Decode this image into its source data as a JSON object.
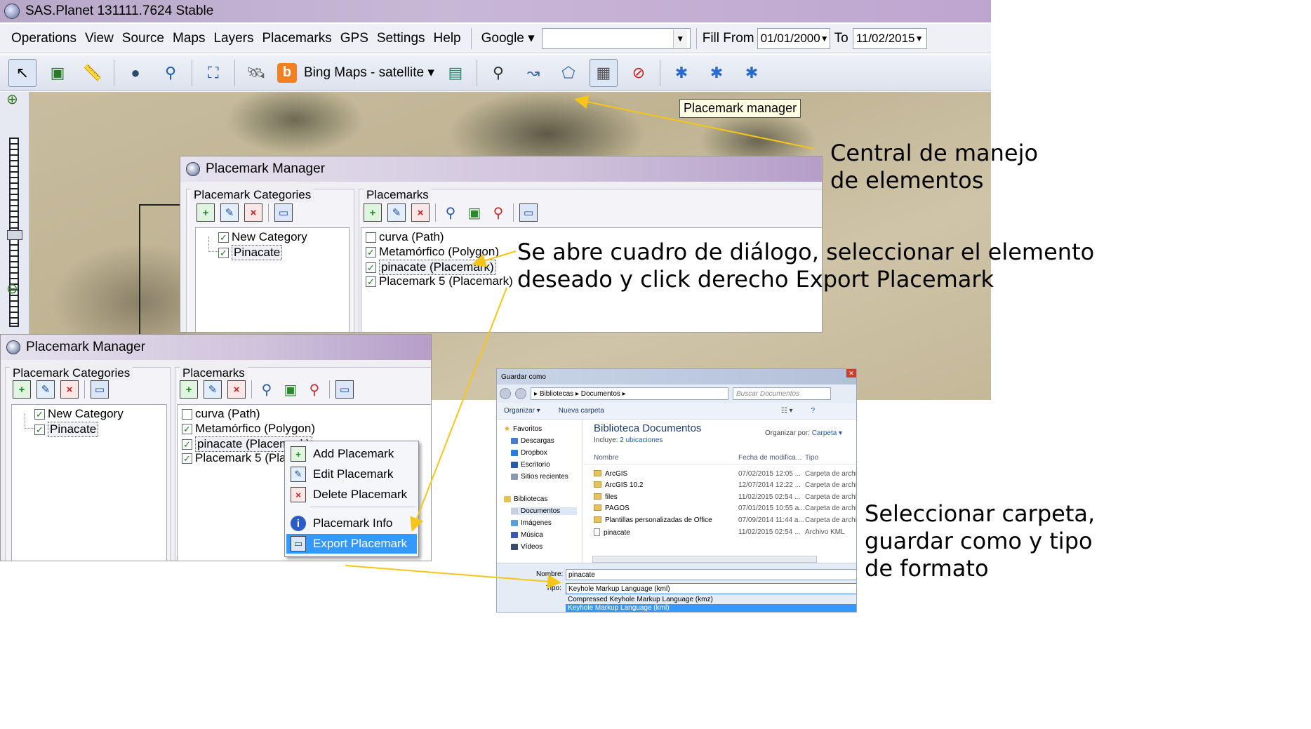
{
  "sas_window": {
    "title": "SAS.Planet 131111.7624 Stable",
    "menu": [
      "Operations",
      "View",
      "Source",
      "Maps",
      "Layers",
      "Placemarks",
      "GPS",
      "Settings",
      "Help"
    ],
    "search_source": "Google",
    "search_value": "",
    "fill_from_label": "Fill From",
    "fill_from_value": "01/01/2000",
    "fill_to_label": "To",
    "fill_to_value": "11/02/2015",
    "map_source_label": "Bing Maps - satellite",
    "zoom_level": "z12",
    "tooltip": "Placemark manager"
  },
  "placemark_manager_back": {
    "title": "Placemark Manager",
    "categories_label": "Placemark Categories",
    "placemarks_label": "Placemarks",
    "categories": [
      {
        "label": "New Category",
        "checked": true
      },
      {
        "label": "Pinacate",
        "checked": true
      }
    ],
    "placemarks": [
      {
        "label": "curva (Path)",
        "checked": false
      },
      {
        "label": "Metamórfico (Polygon)",
        "checked": true
      },
      {
        "label": "pinacate (Placemark)",
        "checked": true
      },
      {
        "label": "Placemark 5 (Placemark)",
        "checked": true
      }
    ]
  },
  "placemark_manager_front": {
    "title": "Placemark Manager",
    "categories_label": "Placemark Categories",
    "placemarks_label": "Placemarks",
    "categories": [
      {
        "label": "New Category",
        "checked": true
      },
      {
        "label": "Pinacate",
        "checked": true
      }
    ],
    "placemarks": [
      {
        "label": "curva (Path)",
        "checked": false
      },
      {
        "label": "Metamórfico (Polygon)",
        "checked": true
      },
      {
        "label": "pinacate (Placemark)",
        "checked": true
      },
      {
        "label": "Placemark 5 (Placem",
        "checked": true
      }
    ],
    "context_menu": [
      {
        "label": "Add Placemark",
        "icon": "add-icon"
      },
      {
        "label": "Edit Placemark",
        "icon": "edit-icon"
      },
      {
        "label": "Delete Placemark",
        "icon": "delete-icon"
      },
      {
        "label": "Placemark Info",
        "icon": "info-icon"
      },
      {
        "label": "Export Placemark",
        "icon": "save-icon",
        "highlighted": true
      }
    ]
  },
  "save_dialog": {
    "title": "Guardar como",
    "path": [
      "Bibliotecas",
      "Documentos"
    ],
    "search_placeholder": "Buscar Documentos",
    "organize": "Organizar",
    "new_folder": "Nueva carpeta",
    "nav": {
      "favorites": "Favoritos",
      "favorites_items": [
        "Descargas",
        "Dropbox",
        "Escritorio",
        "Sitios recientes"
      ],
      "libraries": "Bibliotecas",
      "libraries_items": [
        "Documentos",
        "Imágenes",
        "Música",
        "Vídeos"
      ]
    },
    "library_title": "Biblioteca Documentos",
    "includes_label": "Incluye:",
    "includes_link": "2 ubicaciones",
    "arrange_label": "Organizar por:",
    "arrange_value": "Carpeta",
    "columns": [
      "Nombre",
      "Fecha de modifica...",
      "Tipo"
    ],
    "files": [
      {
        "name": "ArcGIS",
        "date": "07/02/2015 12:05 ...",
        "type": "Carpeta de archiv",
        "kind": "folder"
      },
      {
        "name": "ArcGIS 10.2",
        "date": "12/07/2014 12:22 ...",
        "type": "Carpeta de archiv",
        "kind": "folder"
      },
      {
        "name": "files",
        "date": "11/02/2015 02:54 ...",
        "type": "Carpeta de archiv",
        "kind": "folder"
      },
      {
        "name": "PAGOS",
        "date": "07/01/2015 10:55 a...",
        "type": "Carpeta de archiv",
        "kind": "folder"
      },
      {
        "name": "Plantillas personalizadas de Office",
        "date": "07/09/2014 11:44 a...",
        "type": "Carpeta de archiv",
        "kind": "folder"
      },
      {
        "name": "pinacate",
        "date": "11/02/2015 02:54 ...",
        "type": "Archivo KML",
        "kind": "file"
      }
    ],
    "name_label": "Nombre:",
    "name_value": "pinacate",
    "type_label": "Tipo:",
    "type_value": "Keyhole Markup Language (kml)",
    "type_options": [
      "Compressed Keyhole Markup Language (kmz)",
      "Keyhole Markup Language (kml)"
    ]
  },
  "annotations": {
    "note1": [
      "Central de manejo",
      "de elementos"
    ],
    "note2": [
      "Se abre cuadro de diálogo, seleccionar el elemento",
      "deseado y click derecho Export Placemark"
    ],
    "note3": [
      "Seleccionar carpeta,",
      "guardar como y tipo",
      "de formato"
    ]
  },
  "colors": {
    "arrow": "#f5c518",
    "highlight": "#3399ff",
    "title_gradient": "#c9b7d6"
  }
}
